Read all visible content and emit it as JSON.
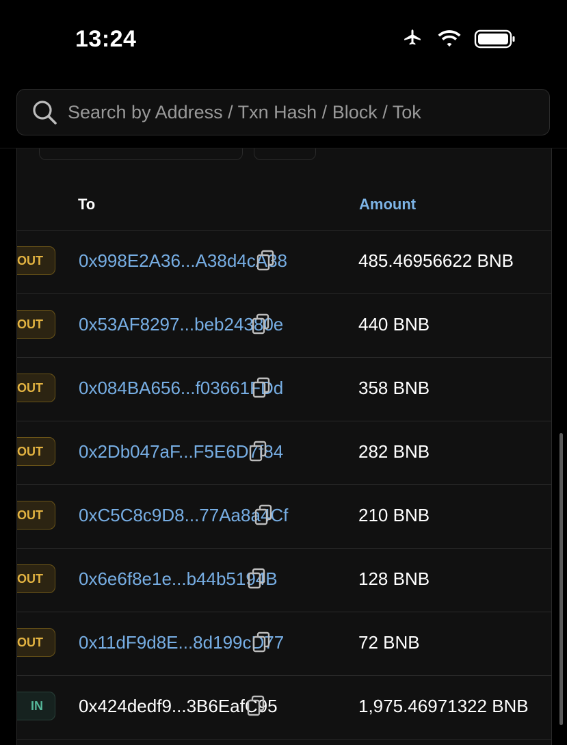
{
  "status_bar": {
    "time": "13:24",
    "icons": [
      "airplane-mode-icon",
      "wifi-icon",
      "battery-icon"
    ]
  },
  "search": {
    "placeholder": "Search by Address / Txn Hash / Block / Tok",
    "value": ""
  },
  "table": {
    "columns": {
      "to": "To",
      "amount": "Amount"
    },
    "rows": [
      {
        "direction": "OUT",
        "to": "0x998E2A36...A38d4cA38",
        "amount": "485.46956622 BNB",
        "to_is_link": true
      },
      {
        "direction": "OUT",
        "to": "0x53AF8297...beb24380e",
        "amount": "440 BNB",
        "to_is_link": true
      },
      {
        "direction": "OUT",
        "to": "0x084BA656...f03661FDd",
        "amount": "358 BNB",
        "to_is_link": true
      },
      {
        "direction": "OUT",
        "to": "0x2Db047aF...F5E6D7f84",
        "amount": "282 BNB",
        "to_is_link": true
      },
      {
        "direction": "OUT",
        "to": "0xC5C8c9D8...77Aa8a4Cf",
        "amount": "210 BNB",
        "to_is_link": true
      },
      {
        "direction": "OUT",
        "to": "0x6e6f8e1e...b44b5194B",
        "amount": "128 BNB",
        "to_is_link": true
      },
      {
        "direction": "OUT",
        "to": "0x11dF9d8E...8d199cD77",
        "amount": "72 BNB",
        "to_is_link": true
      },
      {
        "direction": "IN",
        "to": "0x424dedf9...3B6EafC95",
        "amount": "1,975.46971322 BNB",
        "to_is_link": false
      }
    ]
  },
  "colors": {
    "background": "#000000",
    "card": "#111111",
    "link": "#77aee4",
    "out_badge": "#e3b341",
    "in_badge": "#55b89a"
  }
}
